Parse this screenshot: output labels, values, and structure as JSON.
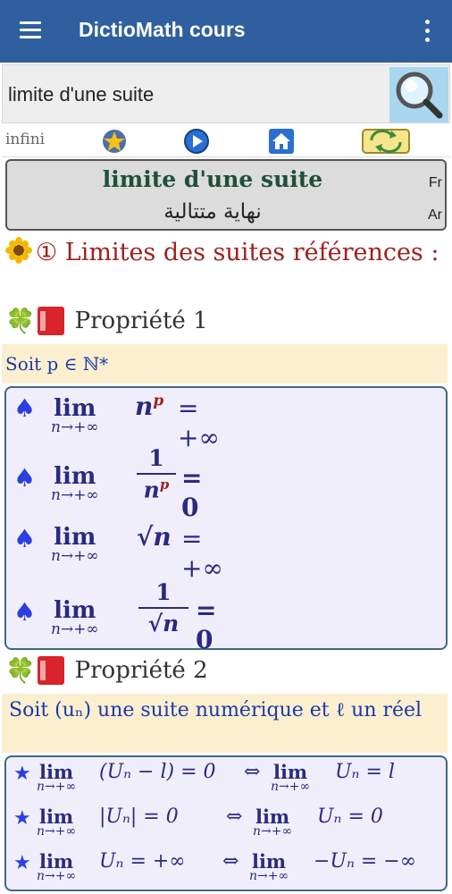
{
  "appbar": {
    "title": "DictioMath cours"
  },
  "search": {
    "value": "limite d'une suite"
  },
  "toolbar": {
    "word": "infini"
  },
  "header": {
    "title_fr": "limite d'une suite",
    "title_ar": "نهاية متتالية",
    "lang_fr": "Fr",
    "lang_ar": "Ar"
  },
  "section": {
    "title": "① Limites des suites références :"
  },
  "prop1": {
    "label": "Propriété 1",
    "note": "Soit p ∈ ℕ*"
  },
  "prop1_formulas": [
    {
      "lim": "lim",
      "sub": "n→+∞",
      "expr": "n",
      "sup": "p",
      "rhs": "= +∞"
    },
    {
      "lim": "lim",
      "sub": "n→+∞",
      "num": "1",
      "den": "n",
      "densup": "p",
      "rhs": "= 0"
    },
    {
      "lim": "lim",
      "sub": "n→+∞",
      "expr": "√n",
      "rhs": "= +∞"
    },
    {
      "lim": "lim",
      "sub": "n→+∞",
      "num": "1",
      "den": "√n",
      "rhs": "= 0"
    }
  ],
  "prop2": {
    "label": "Propriété 2",
    "note": "Soit (uₙ) une suite numérique et ℓ un réel"
  },
  "prop2_formulas": [
    {
      "left_expr": "(Uₙ − l) = 0",
      "equiv": "⇔",
      "right_expr": "Uₙ = l"
    },
    {
      "left_expr": "|Uₙ| = 0",
      "equiv": "⇔",
      "right_expr": "Uₙ = 0"
    },
    {
      "left_expr": "Uₙ = +∞",
      "equiv": "⇔",
      "right_expr": "−Uₙ = −∞"
    }
  ],
  "limit_sub": "n→+∞",
  "colors": {
    "appbar": "#2f5f9f",
    "section": "#a02020",
    "note_bg": "#fcefd0",
    "box_bg": "#f1eefc"
  },
  "icons": {
    "star": "star-icon",
    "play": "play-icon",
    "home": "home-icon",
    "translate": "translate-icon"
  }
}
